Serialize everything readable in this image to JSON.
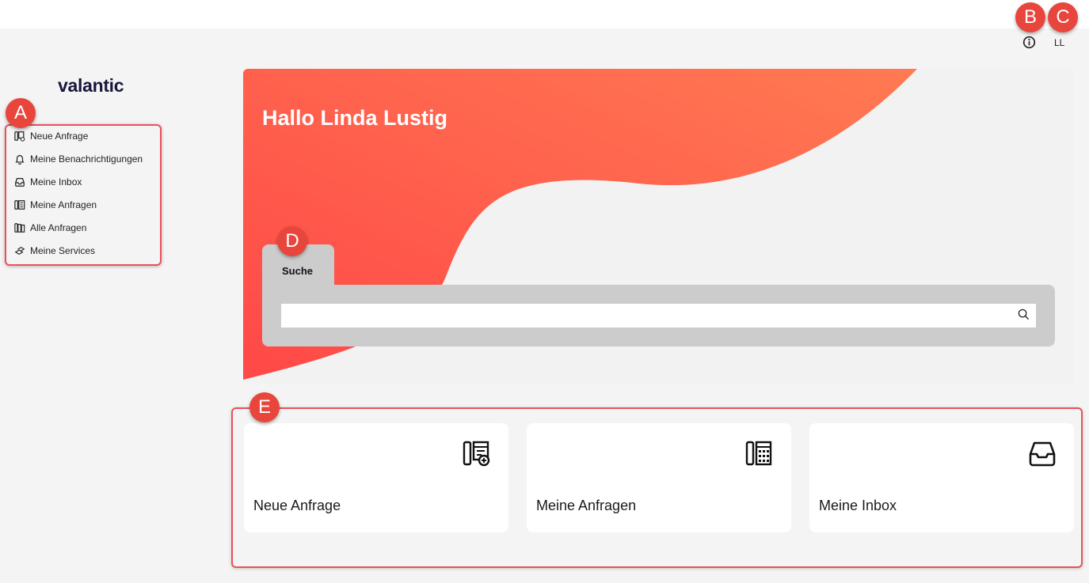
{
  "header": {
    "info_icon": "info-circle-icon",
    "user_initials": "LL"
  },
  "callouts": {
    "a": "A",
    "b": "B",
    "c": "C",
    "d": "D",
    "e": "E"
  },
  "sidebar": {
    "logo": "valantic",
    "items": [
      {
        "label": "Neue Anfrage",
        "icon": "new-request-icon"
      },
      {
        "label": "Meine Benachrichtigungen",
        "icon": "bell-icon"
      },
      {
        "label": "Meine Inbox",
        "icon": "inbox-icon"
      },
      {
        "label": "Meine Anfragen",
        "icon": "requests-icon"
      },
      {
        "label": "Alle Anfragen",
        "icon": "all-requests-icon"
      },
      {
        "label": "Meine Services",
        "icon": "services-icon"
      }
    ]
  },
  "hero": {
    "greeting": "Hallo Linda Lustig"
  },
  "search": {
    "tab_label": "Suche",
    "value": "",
    "placeholder": ""
  },
  "tiles": [
    {
      "label": "Neue Anfrage",
      "icon": "new-request-icon"
    },
    {
      "label": "Meine Anfragen",
      "icon": "requests-icon"
    },
    {
      "label": "Meine Inbox",
      "icon": "inbox-icon"
    }
  ],
  "colors": {
    "accent": "#ff6b4a",
    "accent_dark": "#ff4a4a",
    "callout": "#e8453c",
    "highlight_border": "#e8525a",
    "hero_bg": "#f2f2f2",
    "search_panel": "#cccccc"
  }
}
